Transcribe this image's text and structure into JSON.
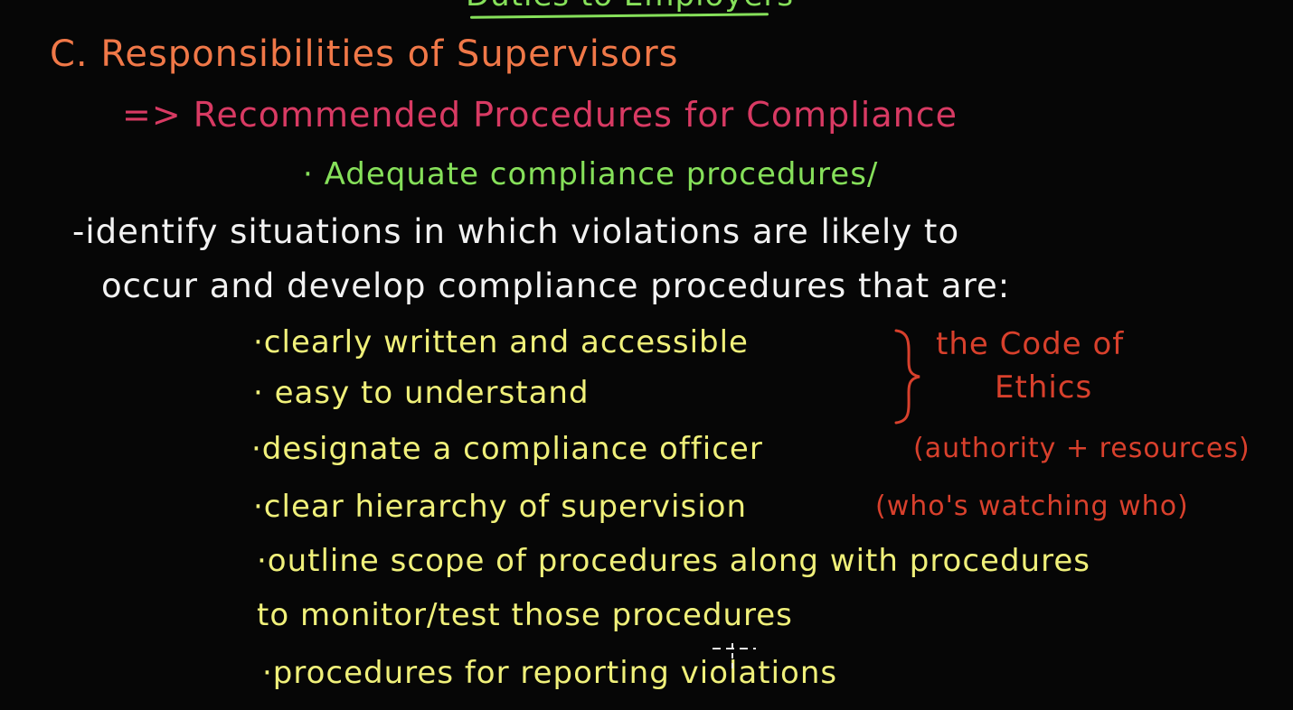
{
  "colors": {
    "background": "#060606",
    "green": "#86e05a",
    "orange": "#f07848",
    "pink": "#d83a63",
    "white": "#f2f2f2",
    "yellow": "#f0f07a",
    "red": "#d8402c"
  },
  "board": {
    "top_title": "Duties to Employers",
    "heading": "C. Responsibilities of Supervisors",
    "sub_heading": "=> Recommended Procedures for Compliance",
    "adequate": "· Adequate compliance procedures/",
    "identify_line1": "-identify situations in which violations are likely to",
    "identify_line2": "occur and develop compliance procedures that are:",
    "bullets": {
      "clearly_written": "·clearly written and accessible",
      "easy": "· easy to understand",
      "designate": "·designate a compliance officer",
      "hierarchy": "·clear hierarchy of supervision",
      "outline_line1": "·outline scope of procedures along with procedures",
      "outline_line2": "to monitor/test those procedures",
      "reporting": "·procedures for reporting violations"
    },
    "notes": {
      "code_line1": "the Code of",
      "code_line2": "Ethics",
      "authority": "(authority + resources)",
      "who_watching": "(who's watching who)"
    }
  }
}
